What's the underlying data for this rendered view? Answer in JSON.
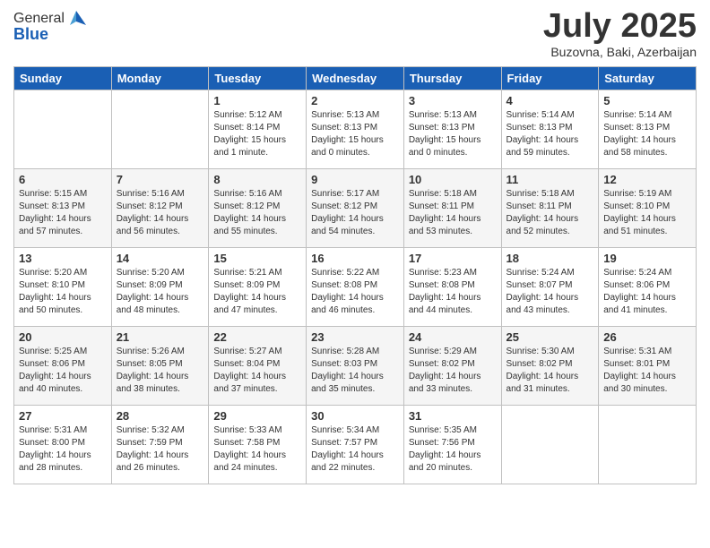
{
  "header": {
    "logo_general": "General",
    "logo_blue": "Blue",
    "title": "July 2025",
    "location": "Buzovna, Baki, Azerbaijan"
  },
  "days_of_week": [
    "Sunday",
    "Monday",
    "Tuesday",
    "Wednesday",
    "Thursday",
    "Friday",
    "Saturday"
  ],
  "weeks": [
    [
      {
        "day": "",
        "info": ""
      },
      {
        "day": "",
        "info": ""
      },
      {
        "day": "1",
        "info": "Sunrise: 5:12 AM\nSunset: 8:14 PM\nDaylight: 15 hours\nand 1 minute."
      },
      {
        "day": "2",
        "info": "Sunrise: 5:13 AM\nSunset: 8:13 PM\nDaylight: 15 hours\nand 0 minutes."
      },
      {
        "day": "3",
        "info": "Sunrise: 5:13 AM\nSunset: 8:13 PM\nDaylight: 15 hours\nand 0 minutes."
      },
      {
        "day": "4",
        "info": "Sunrise: 5:14 AM\nSunset: 8:13 PM\nDaylight: 14 hours\nand 59 minutes."
      },
      {
        "day": "5",
        "info": "Sunrise: 5:14 AM\nSunset: 8:13 PM\nDaylight: 14 hours\nand 58 minutes."
      }
    ],
    [
      {
        "day": "6",
        "info": "Sunrise: 5:15 AM\nSunset: 8:13 PM\nDaylight: 14 hours\nand 57 minutes."
      },
      {
        "day": "7",
        "info": "Sunrise: 5:16 AM\nSunset: 8:12 PM\nDaylight: 14 hours\nand 56 minutes."
      },
      {
        "day": "8",
        "info": "Sunrise: 5:16 AM\nSunset: 8:12 PM\nDaylight: 14 hours\nand 55 minutes."
      },
      {
        "day": "9",
        "info": "Sunrise: 5:17 AM\nSunset: 8:12 PM\nDaylight: 14 hours\nand 54 minutes."
      },
      {
        "day": "10",
        "info": "Sunrise: 5:18 AM\nSunset: 8:11 PM\nDaylight: 14 hours\nand 53 minutes."
      },
      {
        "day": "11",
        "info": "Sunrise: 5:18 AM\nSunset: 8:11 PM\nDaylight: 14 hours\nand 52 minutes."
      },
      {
        "day": "12",
        "info": "Sunrise: 5:19 AM\nSunset: 8:10 PM\nDaylight: 14 hours\nand 51 minutes."
      }
    ],
    [
      {
        "day": "13",
        "info": "Sunrise: 5:20 AM\nSunset: 8:10 PM\nDaylight: 14 hours\nand 50 minutes."
      },
      {
        "day": "14",
        "info": "Sunrise: 5:20 AM\nSunset: 8:09 PM\nDaylight: 14 hours\nand 48 minutes."
      },
      {
        "day": "15",
        "info": "Sunrise: 5:21 AM\nSunset: 8:09 PM\nDaylight: 14 hours\nand 47 minutes."
      },
      {
        "day": "16",
        "info": "Sunrise: 5:22 AM\nSunset: 8:08 PM\nDaylight: 14 hours\nand 46 minutes."
      },
      {
        "day": "17",
        "info": "Sunrise: 5:23 AM\nSunset: 8:08 PM\nDaylight: 14 hours\nand 44 minutes."
      },
      {
        "day": "18",
        "info": "Sunrise: 5:24 AM\nSunset: 8:07 PM\nDaylight: 14 hours\nand 43 minutes."
      },
      {
        "day": "19",
        "info": "Sunrise: 5:24 AM\nSunset: 8:06 PM\nDaylight: 14 hours\nand 41 minutes."
      }
    ],
    [
      {
        "day": "20",
        "info": "Sunrise: 5:25 AM\nSunset: 8:06 PM\nDaylight: 14 hours\nand 40 minutes."
      },
      {
        "day": "21",
        "info": "Sunrise: 5:26 AM\nSunset: 8:05 PM\nDaylight: 14 hours\nand 38 minutes."
      },
      {
        "day": "22",
        "info": "Sunrise: 5:27 AM\nSunset: 8:04 PM\nDaylight: 14 hours\nand 37 minutes."
      },
      {
        "day": "23",
        "info": "Sunrise: 5:28 AM\nSunset: 8:03 PM\nDaylight: 14 hours\nand 35 minutes."
      },
      {
        "day": "24",
        "info": "Sunrise: 5:29 AM\nSunset: 8:02 PM\nDaylight: 14 hours\nand 33 minutes."
      },
      {
        "day": "25",
        "info": "Sunrise: 5:30 AM\nSunset: 8:02 PM\nDaylight: 14 hours\nand 31 minutes."
      },
      {
        "day": "26",
        "info": "Sunrise: 5:31 AM\nSunset: 8:01 PM\nDaylight: 14 hours\nand 30 minutes."
      }
    ],
    [
      {
        "day": "27",
        "info": "Sunrise: 5:31 AM\nSunset: 8:00 PM\nDaylight: 14 hours\nand 28 minutes."
      },
      {
        "day": "28",
        "info": "Sunrise: 5:32 AM\nSunset: 7:59 PM\nDaylight: 14 hours\nand 26 minutes."
      },
      {
        "day": "29",
        "info": "Sunrise: 5:33 AM\nSunset: 7:58 PM\nDaylight: 14 hours\nand 24 minutes."
      },
      {
        "day": "30",
        "info": "Sunrise: 5:34 AM\nSunset: 7:57 PM\nDaylight: 14 hours\nand 22 minutes."
      },
      {
        "day": "31",
        "info": "Sunrise: 5:35 AM\nSunset: 7:56 PM\nDaylight: 14 hours\nand 20 minutes."
      },
      {
        "day": "",
        "info": ""
      },
      {
        "day": "",
        "info": ""
      }
    ]
  ]
}
